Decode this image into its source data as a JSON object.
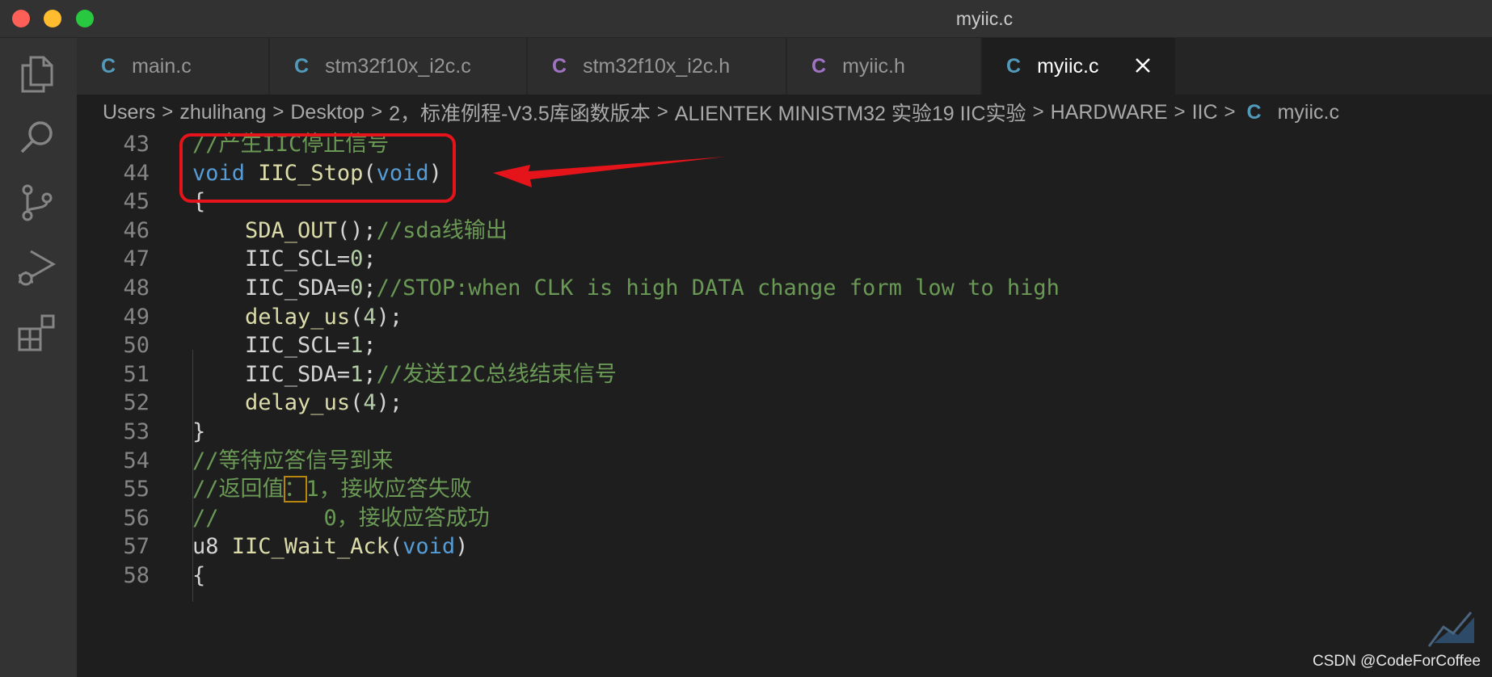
{
  "window": {
    "title": "myiic.c"
  },
  "colors": {
    "accent_red": "#e5141b",
    "c_icon": "#519aba",
    "h_icon": "#a074c4"
  },
  "activity_bar": {
    "icons": [
      "files-icon",
      "search-icon",
      "source-control-icon",
      "run-debug-icon",
      "extensions-icon"
    ]
  },
  "tabs": [
    {
      "lang": "C",
      "label": "main.c"
    },
    {
      "lang": "C",
      "label": "stm32f10x_i2c.c"
    },
    {
      "lang": "C",
      "label": "stm32f10x_i2c.h"
    },
    {
      "lang": "C",
      "label": "myiic.h"
    },
    {
      "lang": "C",
      "label": "myiic.c"
    }
  ],
  "breadcrumb": {
    "parts": [
      "Users",
      "zhulihang",
      "Desktop",
      "2，标准例程-V3.5库函数版本",
      "ALIENTEK MINISTM32 实验19 IIC实验",
      "HARDWARE",
      "IIC"
    ],
    "file_lang": "C",
    "file": "myiic.c"
  },
  "code": {
    "lines": [
      {
        "n": "43",
        "segs": [
          [
            "//产生IIC停止信号",
            "cm"
          ]
        ]
      },
      {
        "n": "44",
        "segs": [
          [
            "void",
            "kw"
          ],
          [
            " ",
            "pl"
          ],
          [
            "IIC_Stop",
            "fn"
          ],
          [
            "(",
            "pl"
          ],
          [
            "void",
            "kw"
          ],
          [
            ")",
            "pl"
          ]
        ]
      },
      {
        "n": "45",
        "segs": [
          [
            "{",
            "pl"
          ]
        ]
      },
      {
        "n": "46",
        "segs": [
          [
            "    ",
            "pl"
          ],
          [
            "SDA_OUT",
            "fn"
          ],
          [
            "();",
            "pl"
          ],
          [
            "//sda线输出",
            "cm"
          ]
        ]
      },
      {
        "n": "47",
        "segs": [
          [
            "    IIC_SCL=",
            "pl"
          ],
          [
            "0",
            "num"
          ],
          [
            ";",
            "pl"
          ]
        ]
      },
      {
        "n": "48",
        "segs": [
          [
            "    IIC_SDA=",
            "pl"
          ],
          [
            "0",
            "num"
          ],
          [
            ";",
            "pl"
          ],
          [
            "//STOP:when CLK is high DATA change form low to high",
            "cm"
          ]
        ]
      },
      {
        "n": "49",
        "segs": [
          [
            "    ",
            "pl"
          ],
          [
            "delay_us",
            "fn"
          ],
          [
            "(",
            "pl"
          ],
          [
            "4",
            "num"
          ],
          [
            ");",
            "pl"
          ]
        ]
      },
      {
        "n": "50",
        "segs": [
          [
            "    IIC_SCL=",
            "pl"
          ],
          [
            "1",
            "num"
          ],
          [
            ";",
            "pl"
          ]
        ]
      },
      {
        "n": "51",
        "segs": [
          [
            "    IIC_SDA=",
            "pl"
          ],
          [
            "1",
            "num"
          ],
          [
            ";",
            "pl"
          ],
          [
            "//发送I2C总线结束信号",
            "cm"
          ]
        ]
      },
      {
        "n": "52",
        "segs": [
          [
            "    ",
            "pl"
          ],
          [
            "delay_us",
            "fn"
          ],
          [
            "(",
            "pl"
          ],
          [
            "4",
            "num"
          ],
          [
            ");",
            "pl"
          ]
        ]
      },
      {
        "n": "53",
        "segs": [
          [
            "}",
            "pl"
          ]
        ]
      },
      {
        "n": "54",
        "segs": [
          [
            "//等待应答信号到来",
            "cm"
          ]
        ]
      },
      {
        "n": "55",
        "segs": [
          [
            "//返回值",
            "cm"
          ],
          [
            "：",
            "cm hl"
          ],
          [
            "1，接收应答失败",
            "cm"
          ]
        ]
      },
      {
        "n": "56",
        "segs": [
          [
            "//        0，接收应答成功",
            "cm"
          ]
        ]
      },
      {
        "n": "57",
        "segs": [
          [
            "u8",
            "pl"
          ],
          [
            " ",
            "pl"
          ],
          [
            "IIC_Wait_Ack",
            "fn"
          ],
          [
            "(",
            "pl"
          ],
          [
            "void",
            "kw"
          ],
          [
            ")",
            "pl"
          ]
        ]
      },
      {
        "n": "58",
        "segs": [
          [
            "{",
            "pl"
          ]
        ]
      }
    ]
  },
  "watermark": "CSDN @CodeForCoffee"
}
